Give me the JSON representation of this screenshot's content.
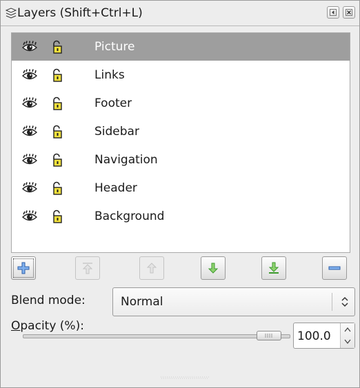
{
  "titlebar": {
    "title": "Layers (Shift+Ctrl+L)"
  },
  "layers": [
    {
      "name": "Picture",
      "selected": true
    },
    {
      "name": "Links",
      "selected": false
    },
    {
      "name": "Footer",
      "selected": false
    },
    {
      "name": "Sidebar",
      "selected": false
    },
    {
      "name": "Navigation",
      "selected": false
    },
    {
      "name": "Header",
      "selected": false
    },
    {
      "name": "Background",
      "selected": false
    }
  ],
  "layer_buttons": [
    {
      "icon": "add-layer-icon",
      "enabled": true
    },
    {
      "icon": "raise-to-top-icon",
      "enabled": false
    },
    {
      "icon": "raise-layer-icon",
      "enabled": false
    },
    {
      "icon": "lower-layer-icon",
      "enabled": true
    },
    {
      "icon": "lower-to-bottom-icon",
      "enabled": true
    },
    {
      "icon": "delete-layer-icon",
      "enabled": true
    }
  ],
  "blend": {
    "label": "Blend mode:",
    "value": "Normal"
  },
  "opacity": {
    "label_mnemonic": "O",
    "label_rest": "pacity (%):",
    "value": "100.0",
    "level": 1.0
  },
  "colors": {
    "selection": "#9e9e9e",
    "arrow_blue": "#3d6fc2",
    "arrow_green": "#3d9a2e",
    "lock_yellow": "#f4e23d"
  }
}
